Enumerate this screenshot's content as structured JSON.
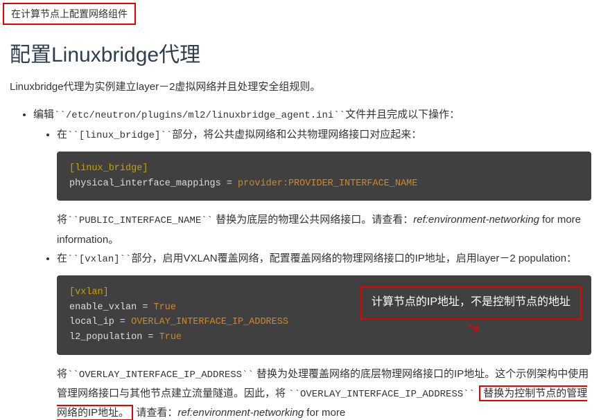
{
  "header_note": "在计算节点上配置网络组件",
  "title": "配置Linuxbridge代理",
  "intro": "Linuxbridge代理为实例建立layer－2虚拟网络并且处理安全组规则。",
  "bullet_edit": {
    "prefix": "编辑",
    "code": "``/etc/neutron/plugins/ml2/linuxbridge_agent.ini``",
    "suffix": "文件并且完成以下操作："
  },
  "sub1": {
    "prefix": "在",
    "code": "``[linux_bridge]``",
    "suffix": "部分，将公共虚拟网络和公共物理网络接口对应起来："
  },
  "code1": {
    "section": "[linux_bridge]",
    "line_key": "physical_interface_mappings = ",
    "line_val": "provider:PROVIDER_INTERFACE_NAME"
  },
  "replace1": {
    "prefix": "将",
    "code": "``PUBLIC_INTERFACE_NAME``",
    "mid": " 替换为底层的物理公共网络接口。请查看：",
    "ref": "ref:environment-networking",
    "suffix": " for more information。"
  },
  "sub2": {
    "prefix": "在",
    "code": "``[vxlan]``",
    "suffix": "部分，启用VXLAN覆盖网络，配置覆盖网络的物理网络接口的IP地址，启用layer－2 population："
  },
  "code2": {
    "section": "[vxlan]",
    "l1k": "enable_vxlan = ",
    "l1v": "True",
    "l2k": "local_ip = ",
    "l2v": "OVERLAY_INTERFACE_IP_ADDRESS",
    "l3k": "l2_population = ",
    "l3v": "True"
  },
  "annotation": "计算节点的IP地址，不是控制节点的地址",
  "replace2": {
    "prefix": "将",
    "code": "``OVERLAY_INTERFACE_IP_ADDRESS``",
    "mid1": " 替换为处理覆盖网络的底层物理网络接口的IP地址。这个示例架构中使用管理网络接口与其他节点建立流量隧道。因此，将 ",
    "code2": "``OVERLAY_INTERFACE_IP_ADDRESS``",
    "inline_annot": "替换为控制节点的管理网络的IP地址。",
    "tail_prefix": "请查看：",
    "tail_ref": "ref:environment-networking",
    "tail_suffix": " for more"
  },
  "watermark": ""
}
